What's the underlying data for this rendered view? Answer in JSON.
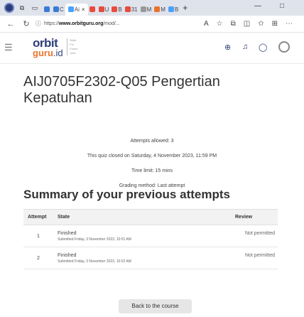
{
  "browser": {
    "tabs": [
      {
        "label": "",
        "color": "#3a7bd5"
      },
      {
        "label": "C",
        "color": "#3a7bd5"
      },
      {
        "label": "Ai",
        "color": "#4aa1ff",
        "active": true
      },
      {
        "label": "",
        "color": "#e84b3c"
      },
      {
        "label": "U",
        "color": "#e84b3c"
      },
      {
        "label": "B",
        "color": "#e84b3c"
      },
      {
        "label": "31",
        "color": "#e84b3c"
      },
      {
        "label": "M",
        "color": "#999999"
      },
      {
        "label": "M",
        "color": "#e8742b"
      },
      {
        "label": "B",
        "color": "#4aa1ff"
      }
    ],
    "new_tab": "+",
    "close_tab": "×",
    "url_prefix": "https://",
    "url_domain": "www.orbitguru.org",
    "url_path": "/mod/...",
    "minimize": "—",
    "maximize": "□"
  },
  "site": {
    "logo_word1": "orbit",
    "logo_word2": "guru",
    "logo_suffix": ".id",
    "tagline": "Skills For Future Jobs"
  },
  "page": {
    "title": "AIJ0705F2302-Q05 Pengertian Kepatuhan",
    "attempts_allowed": "Attempts allowed: 3",
    "closed_on": "This quiz closed on Saturday, 4 November 2023, 11:59 PM",
    "time_limit": "Time limit: 15 mins",
    "grading_method": "Grading method: Last attempt",
    "summary_heading": "Summary of your previous attempts",
    "table_headers": {
      "attempt": "Attempt",
      "state": "State",
      "review": "Review"
    },
    "rows": [
      {
        "attempt": "1",
        "state": "Finished",
        "submitted": "Submitted Friday, 3 November 2023, 10:01 AM",
        "review": "Not permitted"
      },
      {
        "attempt": "2",
        "state": "Finished",
        "submitted": "Submitted Friday, 3 November 2023, 10:02 AM",
        "review": "Not permitted"
      }
    ],
    "back_button": "Back to the course"
  }
}
